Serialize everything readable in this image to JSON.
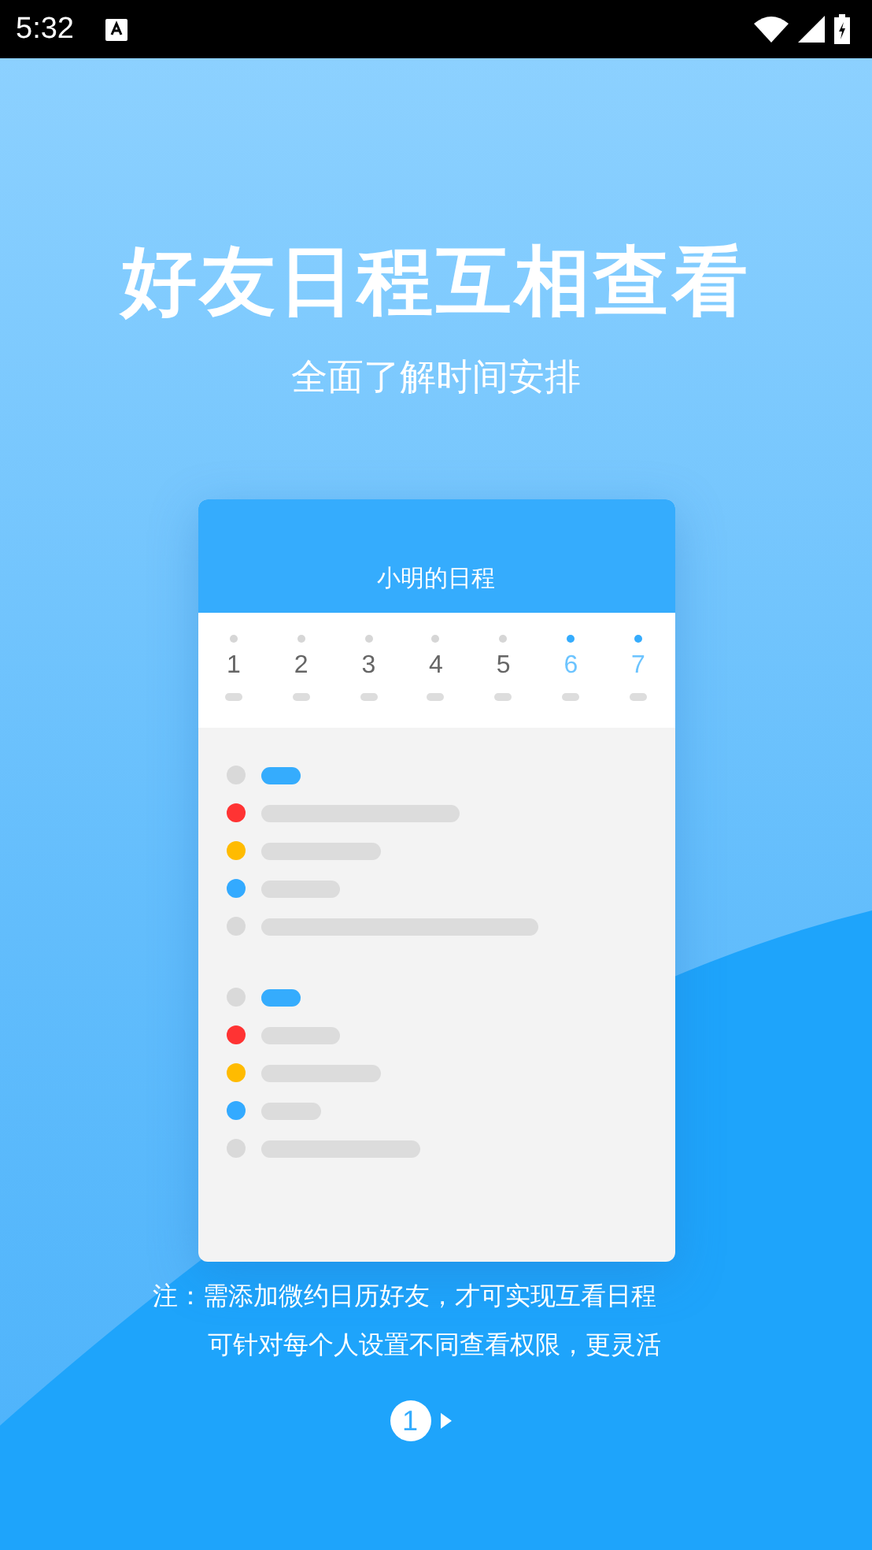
{
  "status_bar": {
    "time": "5:32"
  },
  "title": "好友日程互相查看",
  "subtitle": "全面了解时间安排",
  "card": {
    "title": "小明的日程",
    "days": [
      {
        "label": "1",
        "highlighted": false
      },
      {
        "label": "2",
        "highlighted": false
      },
      {
        "label": "3",
        "highlighted": false
      },
      {
        "label": "4",
        "highlighted": false
      },
      {
        "label": "5",
        "highlighted": false
      },
      {
        "label": "6",
        "highlighted": true
      },
      {
        "label": "7",
        "highlighted": true
      }
    ],
    "groups": [
      [
        {
          "kind": "header",
          "color": "#d9d9d9"
        },
        {
          "kind": "event",
          "color": "#ff3333"
        },
        {
          "kind": "event",
          "color": "#ffbb00"
        },
        {
          "kind": "event",
          "color": "#33aaff"
        },
        {
          "kind": "event",
          "color": "#d9d9d9"
        }
      ],
      [
        {
          "kind": "header",
          "color": "#d9d9d9"
        },
        {
          "kind": "event",
          "color": "#ff3333"
        },
        {
          "kind": "event",
          "color": "#ffbb00"
        },
        {
          "kind": "event",
          "color": "#33aaff"
        },
        {
          "kind": "event",
          "color": "#d9d9d9"
        }
      ]
    ]
  },
  "notes": [
    "注：需添加微约日历好友，才可实现互看日程",
    "可针对每个人设置不同查看权限，更灵活"
  ],
  "pager": {
    "current": "1"
  }
}
